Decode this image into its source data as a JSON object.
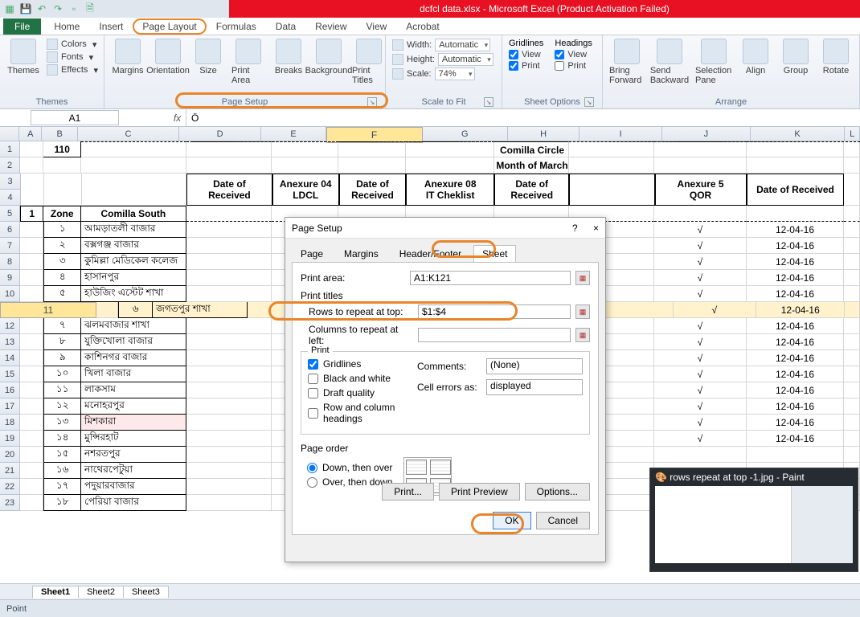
{
  "title_bar": {
    "title": "dcfcl data.xlsx - Microsoft Excel (Product Activation Failed)"
  },
  "ribbon_tabs": {
    "file": "File",
    "tabs": [
      "Home",
      "Insert",
      "Page Layout",
      "Formulas",
      "Data",
      "Review",
      "View",
      "Acrobat"
    ],
    "active": "Page Layout"
  },
  "ribbon": {
    "themes": {
      "label": "Themes",
      "themes_btn": "Themes",
      "colors": "Colors",
      "fonts": "Fonts",
      "effects": "Effects"
    },
    "page_setup": {
      "label": "Page Setup",
      "margins": "Margins",
      "orientation": "Orientation",
      "size": "Size",
      "print_area": "Print Area",
      "breaks": "Breaks",
      "background": "Background",
      "print_titles": "Print Titles"
    },
    "scale": {
      "label": "Scale to Fit",
      "width_l": "Width:",
      "width_v": "Automatic",
      "height_l": "Height:",
      "height_v": "Automatic",
      "scale_l": "Scale:",
      "scale_v": "74%"
    },
    "sheet_options": {
      "label": "Sheet Options",
      "gridlines": "Gridlines",
      "headings": "Headings",
      "view": "View",
      "print": "Print"
    },
    "arrange": {
      "label": "Arrange",
      "bring": "Bring Forward",
      "send": "Send Backward",
      "selpane": "Selection Pane",
      "align": "Align",
      "group": "Group",
      "rotate": "Rotate"
    }
  },
  "namebox": "A1",
  "formula": "Ö",
  "columns": [
    "A",
    "B",
    "C",
    "D",
    "E",
    "F",
    "G",
    "H",
    "I",
    "J",
    "K",
    "L"
  ],
  "sheet": {
    "row1_b": "110",
    "row1_title": "Comilla Circle",
    "row2_title": "Month of March",
    "hdr": [
      "Date of Received",
      "Anexure 04 LDCL",
      "Date of Received",
      "Anexure 08 IT Cheklist",
      "Date of Received",
      "Anexure 5 QOR",
      "Date of Received"
    ],
    "zone_l": "1 Zone",
    "zone_v": "Comilla South",
    "rows": [
      {
        "n": "১",
        "name": "আমড়াতলী বাজার",
        "j": "√",
        "k": "12-04-16"
      },
      {
        "n": "২",
        "name": "বক্সগঞ্জ বাজার",
        "j": "√",
        "k": "12-04-16"
      },
      {
        "n": "৩",
        "name": "কুমিল্লা মেডিকেল কলেজ",
        "j": "√",
        "k": "12-04-16"
      },
      {
        "n": "৪",
        "name": "হাসানপুর",
        "j": "√",
        "k": "12-04-16"
      },
      {
        "n": "৫",
        "name": "হাউজিং এস্টেট শাখা",
        "j": "√",
        "k": "12-04-16"
      },
      {
        "n": "৬",
        "name": "জগতপুর শাখা",
        "j": "√",
        "k": "12-04-16"
      },
      {
        "n": "৭",
        "name": "ঝলমবাজার শাখা",
        "j": "√",
        "k": "12-04-16"
      },
      {
        "n": "৮",
        "name": "যুক্তিখোলা বাজার",
        "j": "√",
        "k": "12-04-16"
      },
      {
        "n": "৯",
        "name": "কাশিনগর বাজার",
        "j": "√",
        "k": "12-04-16"
      },
      {
        "n": "১০",
        "name": "খিলা বাজার",
        "j": "√",
        "k": "12-04-16"
      },
      {
        "n": "১১",
        "name": "লাকসাম",
        "j": "√",
        "k": "12-04-16"
      },
      {
        "n": "১২",
        "name": "মনোহরপুর",
        "j": "√",
        "k": "12-04-16"
      },
      {
        "n": "১৩",
        "name": "মিশকারা",
        "j": "√",
        "k": "12-04-16"
      },
      {
        "n": "১৪",
        "name": "মুন্সিরহাট",
        "j": "√",
        "k": "12-04-16"
      },
      {
        "n": "১৫",
        "name": "নশরতপুর",
        "j": "",
        "k": ""
      },
      {
        "n": "১৬",
        "name": "নাথেরপেটুয়া",
        "j": "",
        "k": ""
      },
      {
        "n": "১৭",
        "name": "পদুয়ারবাজার",
        "j": "",
        "k": ""
      },
      {
        "n": "১৮",
        "name": "পেরিয়া বাজার",
        "j": "",
        "k": ""
      }
    ]
  },
  "sheet_tabs": [
    "Sheet1",
    "Sheet2",
    "Sheet3"
  ],
  "status": "Point",
  "dialog": {
    "title": "Page Setup",
    "help": "?",
    "close": "×",
    "tabs": [
      "Page",
      "Margins",
      "Header/Footer",
      "Sheet"
    ],
    "active": "Sheet",
    "print_area_l": "Print area:",
    "print_area_v": "A1:K121",
    "print_titles": "Print titles",
    "rows_l": "Rows to repeat at top:",
    "rows_v": "$1:$4",
    "cols_l": "Columns to repeat at left:",
    "cols_v": "",
    "print_grp": "Print",
    "gridlines": "Gridlines",
    "bw": "Black and white",
    "draft": "Draft quality",
    "rch": "Row and column headings",
    "comments_l": "Comments:",
    "comments_v": "(None)",
    "errors_l": "Cell errors as:",
    "errors_v": "displayed",
    "page_order": "Page order",
    "down": "Down, then over",
    "over": "Over, then down",
    "print_btn": "Print...",
    "preview": "Print Preview",
    "options": "Options...",
    "ok": "OK",
    "cancel": "Cancel"
  },
  "paint_thumb": "rows repeat at top -1.jpg - Paint"
}
